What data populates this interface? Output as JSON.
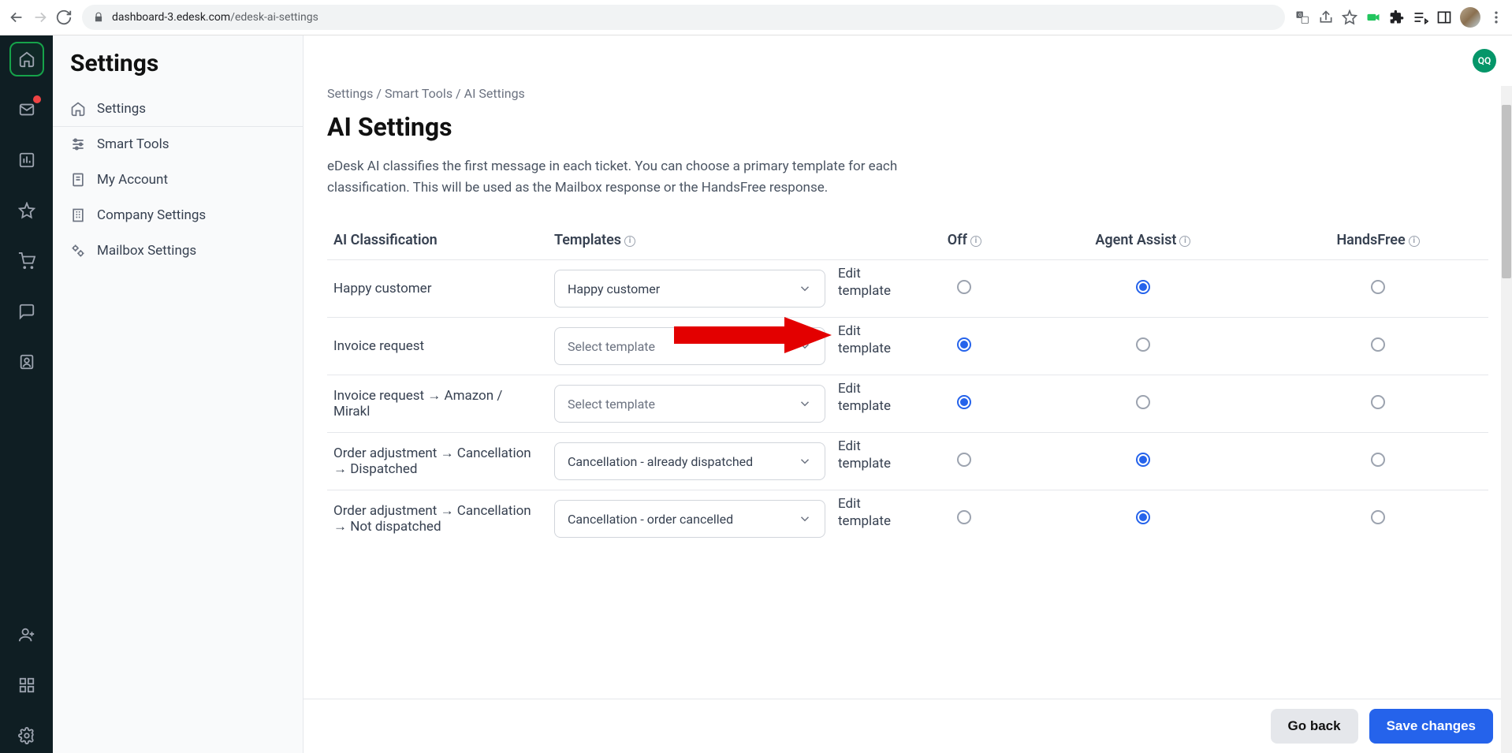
{
  "browser": {
    "url_domain": "dashboard-3.edesk.com",
    "url_path": "/edesk-ai-settings"
  },
  "rail": {
    "items": [
      "home",
      "mail",
      "chart",
      "star",
      "cart",
      "chat",
      "contact"
    ],
    "bottom": [
      "person-add",
      "apps",
      "gear"
    ]
  },
  "sidebar": {
    "title": "Settings",
    "items": [
      {
        "label": "Settings",
        "icon": "home"
      },
      {
        "label": "Smart Tools",
        "icon": "sliders"
      },
      {
        "label": "My Account",
        "icon": "account"
      },
      {
        "label": "Company Settings",
        "icon": "building"
      },
      {
        "label": "Mailbox Settings",
        "icon": "gear"
      }
    ]
  },
  "user_badge": "QQ",
  "breadcrumbs": [
    "Settings",
    "Smart Tools",
    "AI Settings"
  ],
  "page": {
    "title": "AI Settings",
    "description": "eDesk AI classifies the first message in each ticket. You can choose a primary template for each classification. This will be used as the Mailbox response or the HandsFree response."
  },
  "table": {
    "headers": {
      "classification": "AI Classification",
      "templates": "Templates",
      "off": "Off",
      "agent_assist": "Agent Assist",
      "handsfree": "HandsFree"
    },
    "edit_link": "Edit template",
    "placeholder": "Select template",
    "rows": [
      {
        "name": "Happy customer",
        "template": "Happy customer",
        "mode": "agent"
      },
      {
        "name": "Invoice request",
        "template": "",
        "mode": "off"
      },
      {
        "name": "Invoice request → Amazon / Mirakl",
        "template": "",
        "mode": "off"
      },
      {
        "name": "Order adjustment → Cancellation → Dispatched",
        "template": "Cancellation - already dispatched",
        "mode": "agent"
      },
      {
        "name": "Order adjustment → Cancellation → Not dispatched",
        "template": "Cancellation - order cancelled",
        "mode": "agent"
      }
    ]
  },
  "buttons": {
    "back": "Go back",
    "save": "Save changes"
  }
}
